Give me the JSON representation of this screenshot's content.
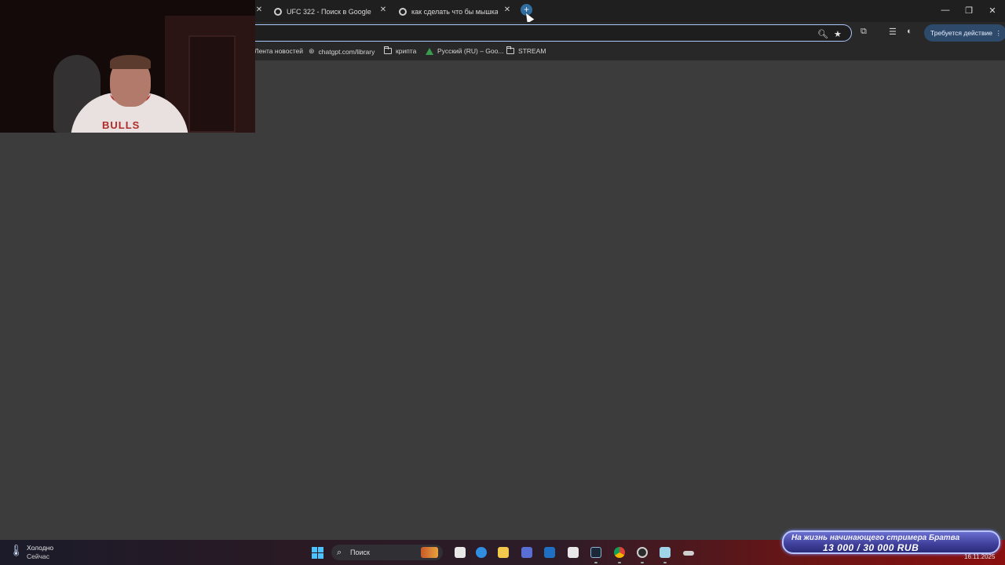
{
  "browser": {
    "tabs": [
      {
        "title": "UFC 322 - Поиск в Google"
      },
      {
        "title": "как сделать что бы мышка не"
      }
    ],
    "new_tab_label": "+",
    "window_controls": {
      "minimize": "—",
      "restore": "❐",
      "close": "✕"
    }
  },
  "toolbar": {
    "action_button_label": "Требуется действие",
    "action_button_menu": "⋮"
  },
  "bookmarks": [
    {
      "label": "Лента новостей",
      "icon": "none"
    },
    {
      "label": "chatgpt.com/library",
      "icon": "openai-icon"
    },
    {
      "label": "крипта",
      "icon": "folder-icon"
    },
    {
      "label": "Русский (RU) – Goo...",
      "icon": "google-drive-icon"
    },
    {
      "label": "STREAM",
      "icon": "folder-icon"
    }
  ],
  "webcam": {
    "jersey_text": "BULLS"
  },
  "taskbar": {
    "weather_condition": "Холодно",
    "weather_time": "Сейчас",
    "search_placeholder": "Поиск",
    "date": "16.11.2025"
  },
  "donation": {
    "line1": "На жизнь начинающего стримера Братва",
    "line2": "13 000 / 30 000 RUB"
  },
  "colors": {
    "page_bg": "#3c3c3c",
    "omnibox_focus": "#a8c7fa",
    "action_pill_bg": "#2d4a6b",
    "windows_accent": "#4cc2ff"
  }
}
